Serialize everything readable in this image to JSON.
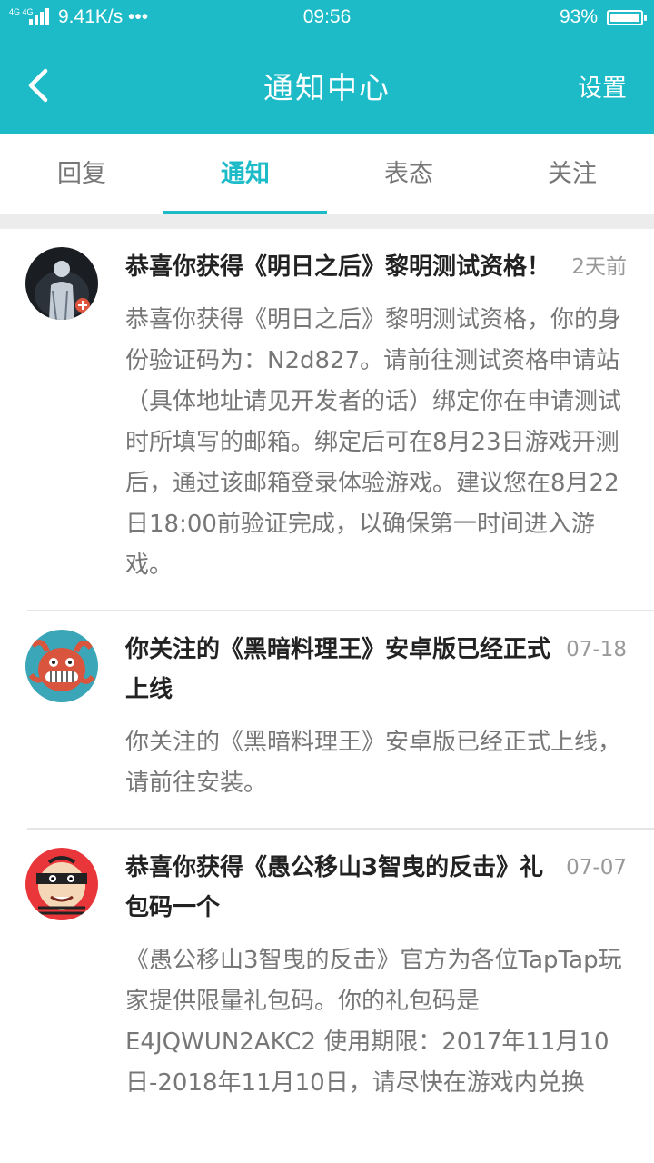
{
  "status_bar": {
    "signal": "4G 4G",
    "network_speed": "9.41K/s •••",
    "time": "09:56",
    "battery": "93%"
  },
  "nav": {
    "back_icon": "chevron-left-icon",
    "title": "通知中心",
    "settings_label": "设置"
  },
  "tabs": [
    {
      "label": "回复",
      "active": false
    },
    {
      "label": "通知",
      "active": true
    },
    {
      "label": "表态",
      "active": false
    },
    {
      "label": "关注",
      "active": false
    }
  ],
  "colors": {
    "accent": "#1dbbc8"
  },
  "notifications": [
    {
      "avatar": "silhouette-avatar",
      "title": "恭喜你获得《明日之后》黎明测试资格！",
      "date": "2天前",
      "body": "恭喜你获得《明日之后》黎明测试资格，你的身份验证码为：N2d827。请前往测试资格申请站（具体地址请见开发者的话）绑定你在申请测试时所填写的邮箱。绑定后可在8月23日游戏开测后，通过该邮箱登录体验游戏。建议您在8月22日18:00前验证完成，以确保第一时间进入游戏。"
    },
    {
      "avatar": "octopus-avatar",
      "title": "你关注的《黑暗料理王》安卓版已经正式上线",
      "date": "07-18",
      "body": "你关注的《黑暗料理王》安卓版已经正式上线，请前往安装。"
    },
    {
      "avatar": "bandit-avatar",
      "title": "恭喜你获得《愚公移山3智曳的反击》礼包码一个",
      "date": "07-07",
      "body": "《愚公移山3智曳的反击》官方为各位TapTap玩家提供限量礼包码。你的礼包码是E4JQWUN2AKC2 使用期限：2017年11月10日-2018年11月10日，请尽快在游戏内兑换"
    }
  ]
}
